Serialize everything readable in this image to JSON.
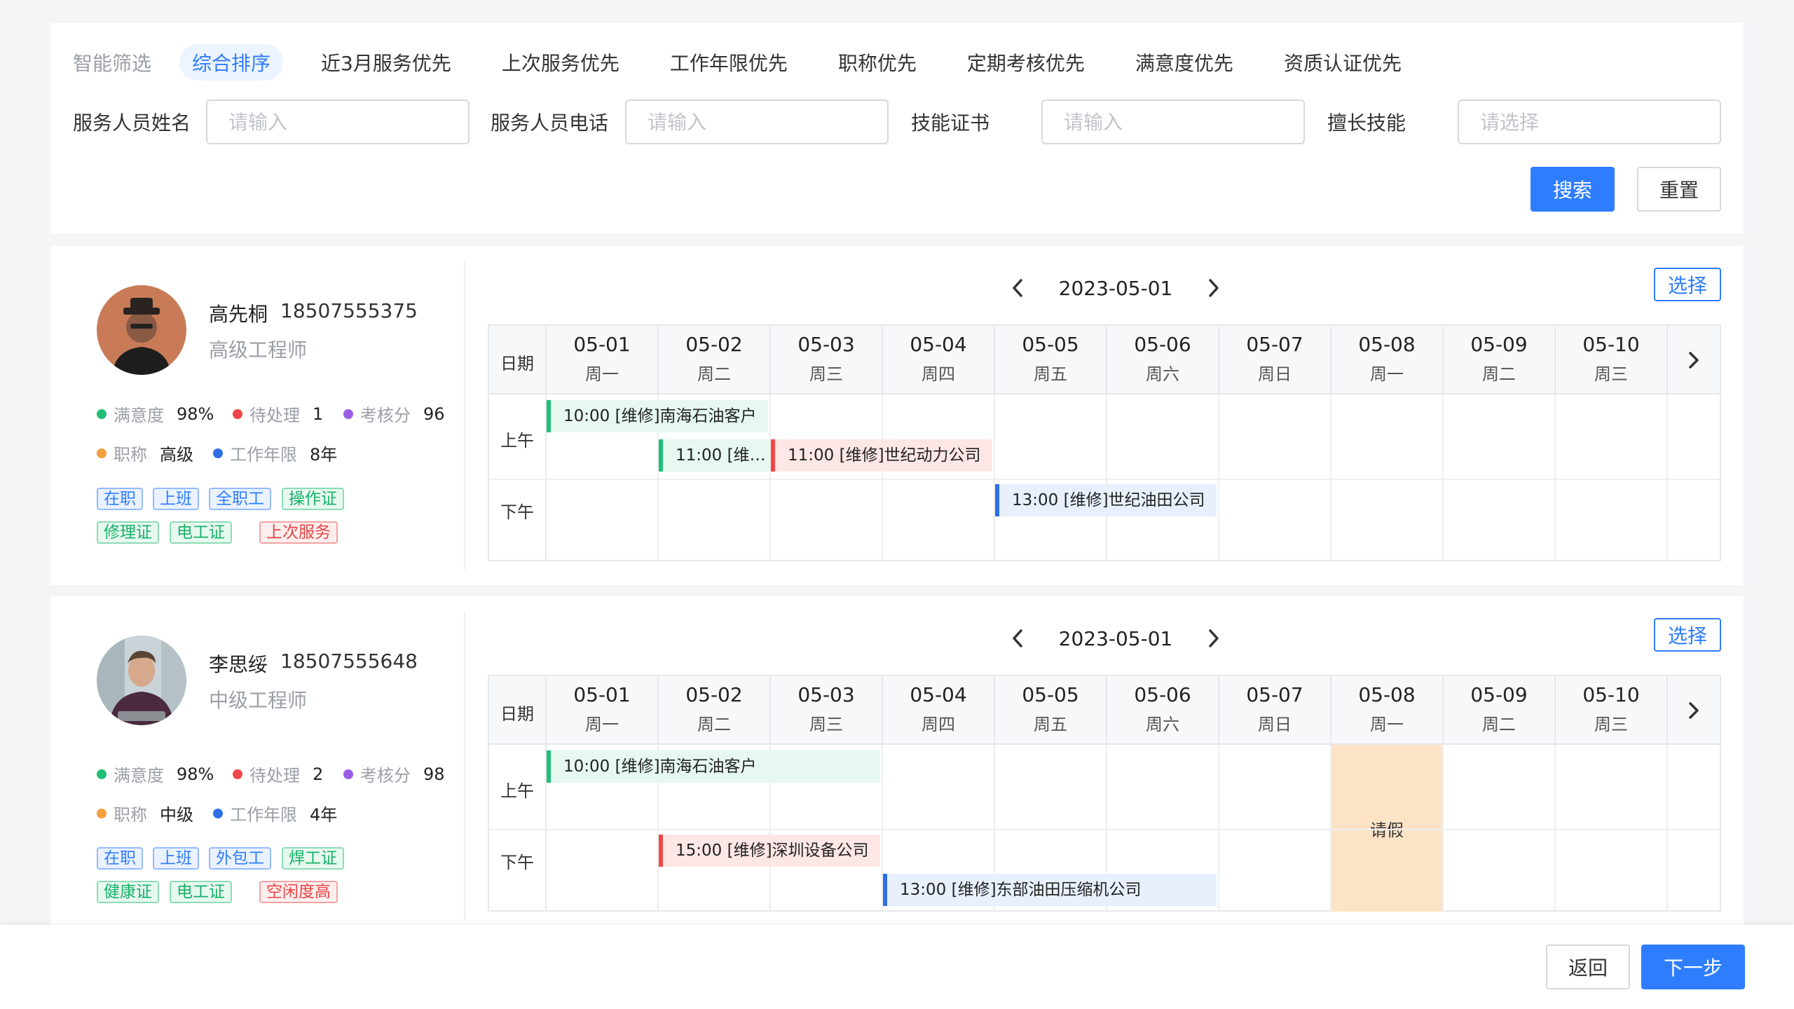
{
  "filter": {
    "sort_label": "智能筛选",
    "sort_items": [
      "综合排序",
      "近3月服务优先",
      "上次服务优先",
      "工作年限优先",
      "职称优先",
      "定期考核优先",
      "满意度优先",
      "资质认证优先"
    ],
    "fields": [
      {
        "label": "服务人员姓名",
        "placeholder": "请输入"
      },
      {
        "label": "服务人员电话",
        "placeholder": "请输入"
      },
      {
        "label": "技能证书",
        "placeholder": "请输入"
      },
      {
        "label": "擅长技能",
        "placeholder": "请选择"
      }
    ],
    "search_label": "搜索",
    "reset_label": "重置"
  },
  "staff": [
    {
      "name": "高先桐",
      "phone": "18507555375",
      "title": "高级工程师",
      "stats": {
        "satisfaction_label": "满意度",
        "satisfaction": "98%",
        "pending_label": "待处理",
        "pending": "1",
        "score_label": "考核分",
        "score": "96",
        "rank_label": "职称",
        "rank": "高级",
        "years_label": "工作年限",
        "years": "8年"
      },
      "tags": [
        {
          "text": "在职",
          "color": "blue"
        },
        {
          "text": "上班",
          "color": "blue"
        },
        {
          "text": "全职工",
          "color": "blue"
        },
        {
          "text": "操作证",
          "color": "green"
        },
        {
          "text": "修理证",
          "color": "green"
        },
        {
          "text": "电工证",
          "color": "green"
        },
        {
          "text": "上次服务",
          "color": "red"
        }
      ],
      "schedule": {
        "date": "2023-05-01",
        "select_label": "选择",
        "date_label": "日期",
        "am_label": "上午",
        "pm_label": "下午",
        "days": [
          {
            "date": "05-01",
            "week": "周一"
          },
          {
            "date": "05-02",
            "week": "周二"
          },
          {
            "date": "05-03",
            "week": "周三"
          },
          {
            "date": "05-04",
            "week": "周四"
          },
          {
            "date": "05-05",
            "week": "周五"
          },
          {
            "date": "05-06",
            "week": "周六"
          },
          {
            "date": "05-07",
            "week": "周日"
          },
          {
            "date": "05-08",
            "week": "周一"
          },
          {
            "date": "05-09",
            "week": "周二"
          },
          {
            "date": "05-10",
            "week": "周三"
          }
        ],
        "events": [
          {
            "text": "10:00 [维修]南海石油客户",
            "color": "green"
          },
          {
            "text": "11:00 [维修]..",
            "color": "green"
          },
          {
            "text": "11:00 [维修]世纪动力公司",
            "color": "red"
          },
          {
            "text": "13:00 [维修]世纪油田公司",
            "color": "blue"
          }
        ]
      }
    },
    {
      "name": "李思绥",
      "phone": "18507555648",
      "title": "中级工程师",
      "stats": {
        "satisfaction_label": "满意度",
        "satisfaction": "98%",
        "pending_label": "待处理",
        "pending": "2",
        "score_label": "考核分",
        "score": "98",
        "rank_label": "职称",
        "rank": "中级",
        "years_label": "工作年限",
        "years": "4年"
      },
      "tags": [
        {
          "text": "在职",
          "color": "blue"
        },
        {
          "text": "上班",
          "color": "blue"
        },
        {
          "text": "外包工",
          "color": "blue"
        },
        {
          "text": "焊工证",
          "color": "green"
        },
        {
          "text": "健康证",
          "color": "green"
        },
        {
          "text": "电工证",
          "color": "green"
        },
        {
          "text": "空闲度高",
          "color": "red"
        }
      ],
      "schedule": {
        "date": "2023-05-01",
        "select_label": "选择",
        "date_label": "日期",
        "am_label": "上午",
        "pm_label": "下午",
        "days": [
          {
            "date": "05-01",
            "week": "周一"
          },
          {
            "date": "05-02",
            "week": "周二"
          },
          {
            "date": "05-03",
            "week": "周三"
          },
          {
            "date": "05-04",
            "week": "周四"
          },
          {
            "date": "05-05",
            "week": "周五"
          },
          {
            "date": "05-06",
            "week": "周六"
          },
          {
            "date": "05-07",
            "week": "周日"
          },
          {
            "date": "05-08",
            "week": "周一"
          },
          {
            "date": "05-09",
            "week": "周二"
          },
          {
            "date": "05-10",
            "week": "周三"
          }
        ],
        "events": [
          {
            "text": "10:00 [维修]南海石油客户",
            "color": "green"
          },
          {
            "text": "15:00 [维修]深圳设备公司",
            "color": "red"
          },
          {
            "text": "13:00 [维修]东部油田压缩机公司",
            "color": "blue"
          }
        ],
        "leave_label": "请假"
      }
    }
  ],
  "footer": {
    "back_label": "返回",
    "next_label": "下一步"
  },
  "colors": {
    "primary": "#2f7dff",
    "satisfaction_dot": "#1fbf75",
    "pending_dot": "#f04646",
    "score_dot": "#9b5de5",
    "rank_dot": "#f5a040",
    "years_dot": "#2f6fe6",
    "leave_bg": "#fde3c6"
  }
}
